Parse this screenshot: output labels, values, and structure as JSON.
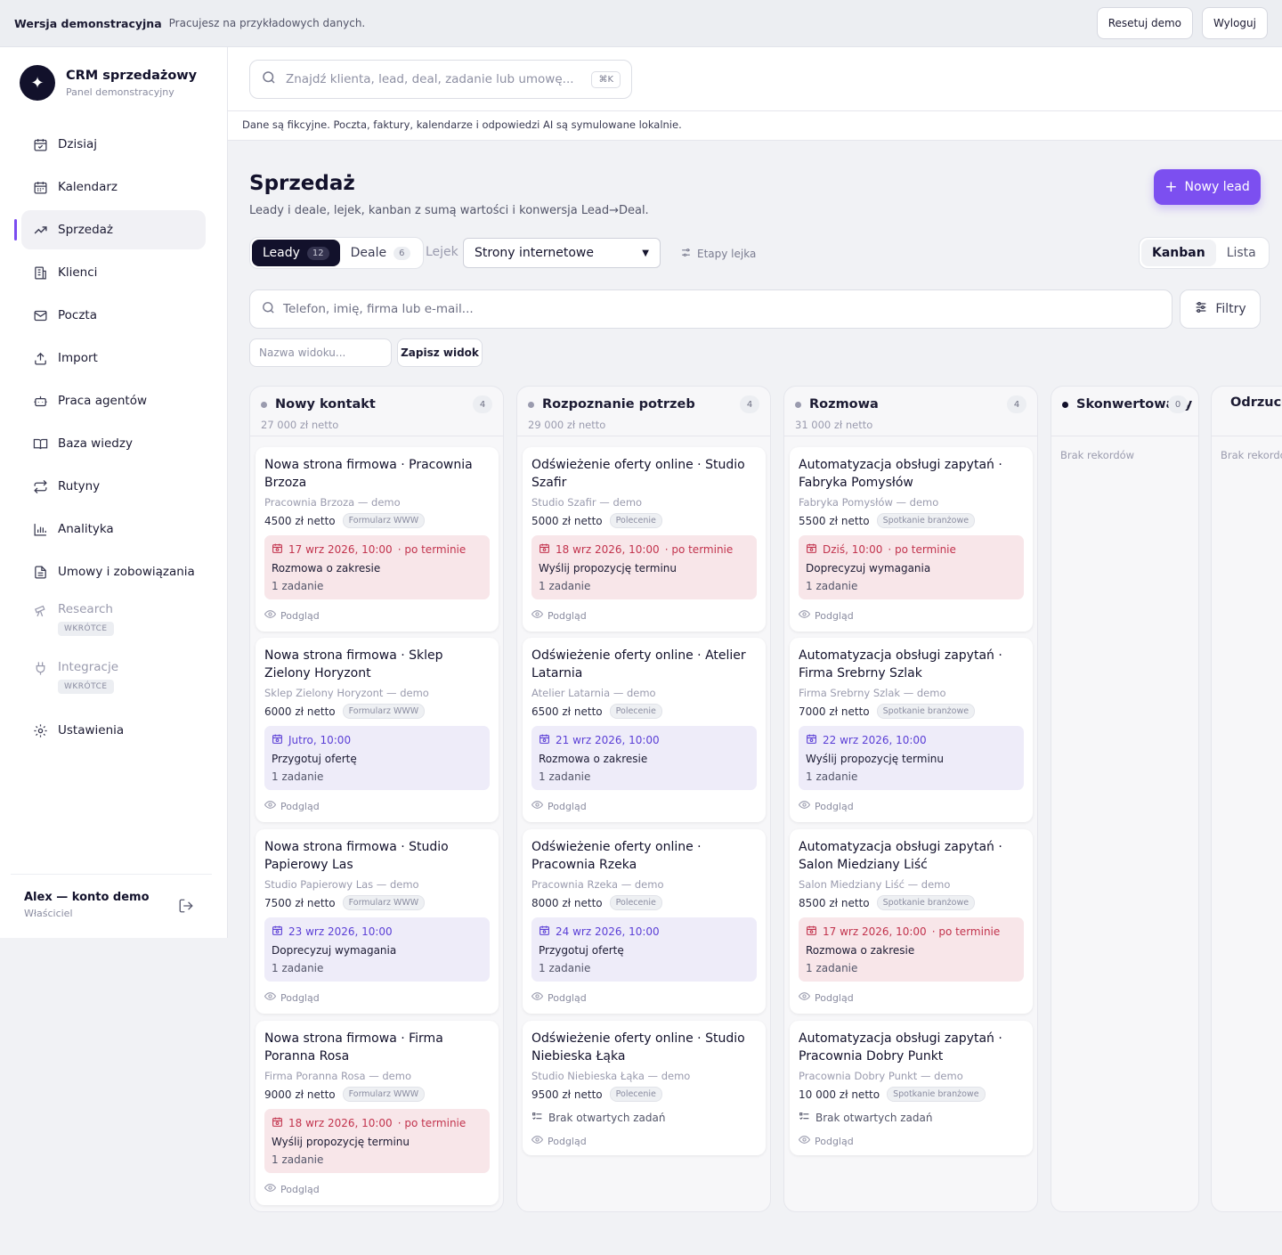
{
  "topbar": {
    "title": "Wersja demonstracyjna",
    "note": "Pracujesz na przykładowych danych.",
    "reset": "Resetuj demo",
    "logout": "Wyloguj"
  },
  "brand": {
    "name": "CRM sprzedażowy",
    "sub": "Panel demonstracyjny"
  },
  "nav": {
    "items": [
      {
        "label": "Dzisiaj",
        "icon": "calendar-check-icon"
      },
      {
        "label": "Kalendarz",
        "icon": "calendar-icon"
      },
      {
        "label": "Sprzedaż",
        "icon": "trending-up-icon",
        "active": true
      },
      {
        "label": "Klienci",
        "icon": "building-icon"
      },
      {
        "label": "Poczta",
        "icon": "mail-icon"
      },
      {
        "label": "Import",
        "icon": "upload-icon"
      },
      {
        "label": "Praca agentów",
        "icon": "bot-icon"
      },
      {
        "label": "Baza wiedzy",
        "icon": "book-icon"
      },
      {
        "label": "Rutyny",
        "icon": "repeat-icon"
      },
      {
        "label": "Analityka",
        "icon": "bar-chart-icon"
      },
      {
        "label": "Umowy i zobowiązania",
        "icon": "file-icon"
      }
    ],
    "soon": [
      {
        "label": "Research",
        "badge": "WKRÓTCE",
        "icon": "telescope-icon"
      },
      {
        "label": "Integracje",
        "badge": "WKRÓTCE",
        "icon": "plug-icon"
      }
    ],
    "settings": "Ustawienia"
  },
  "user": {
    "name": "Alex — konto demo",
    "role": "Właściciel"
  },
  "search": {
    "placeholder": "Znajdź klienta, lead, deal, zadanie lub umowę...",
    "shortcut": "⌘K"
  },
  "notice": "Dane są fikcyjne. Poczta, faktury, kalendarze i odpowiedzi AI są symulowane lokalnie.",
  "page": {
    "title": "Sprzedaż",
    "subtitle": "Leady i deale, lejek, kanban z sumą wartości i konwersja Lead→Deal.",
    "new_lead": "Nowy lead"
  },
  "tabs": {
    "leads": "Leady",
    "leads_count": "12",
    "deals": "Deale",
    "deals_count": "6"
  },
  "funnel": {
    "label": "Lejek",
    "selected": "Strony internetowe",
    "stages": "Etapy lejka"
  },
  "view": {
    "kanban": "Kanban",
    "list": "Lista"
  },
  "filter": {
    "placeholder": "Telefon, imię, firma lub e-mail...",
    "filters": "Filtry",
    "view_name": "Nazwa widoku...",
    "save": "Zapisz widok"
  },
  "columns": [
    {
      "title": "Nowy kontakt",
      "count": "4",
      "sum": "27 000 zł netto",
      "dot": "#9a9bae",
      "cards": [
        {
          "title": "Nowa strona firmowa · Pracownia Brzoza",
          "company": "Pracownia Brzoza — demo",
          "value": "4500 zł netto",
          "tag": "Formularz WWW",
          "task": {
            "date": "17 wrz 2026, 10:00",
            "overdue": "· po terminie",
            "action": "Rozmowa o zakresie",
            "count": "1 zadanie",
            "kind": "red"
          },
          "preview": "Podgląd"
        },
        {
          "title": "Nowa strona firmowa · Sklep Zielony Horyzont",
          "company": "Sklep Zielony Horyzont — demo",
          "value": "6000 zł netto",
          "tag": "Formularz WWW",
          "task": {
            "date": "Jutro, 10:00",
            "overdue": "",
            "action": "Przygotuj ofertę",
            "count": "1 zadanie",
            "kind": "purple"
          },
          "preview": "Podgląd"
        },
        {
          "title": "Nowa strona firmowa · Studio Papierowy Las",
          "company": "Studio Papierowy Las — demo",
          "value": "7500 zł netto",
          "tag": "Formularz WWW",
          "task": {
            "date": "23 wrz 2026, 10:00",
            "overdue": "",
            "action": "Doprecyzuj wymagania",
            "count": "1 zadanie",
            "kind": "purple"
          },
          "preview": "Podgląd"
        },
        {
          "title": "Nowa strona firmowa · Firma Poranna Rosa",
          "company": "Firma Poranna Rosa — demo",
          "value": "9000 zł netto",
          "tag": "Formularz WWW",
          "task": {
            "date": "18 wrz 2026, 10:00",
            "overdue": "· po terminie",
            "action": "Wyślij propozycję terminu",
            "count": "1 zadanie",
            "kind": "red"
          },
          "preview": "Podgląd"
        }
      ]
    },
    {
      "title": "Rozpoznanie potrzeb",
      "count": "4",
      "sum": "29 000 zł netto",
      "dot": "#9a9bae",
      "cards": [
        {
          "title": "Odświeżenie oferty online · Studio Szafir",
          "company": "Studio Szafir — demo",
          "value": "5000 zł netto",
          "tag": "Polecenie",
          "task": {
            "date": "18 wrz 2026, 10:00",
            "overdue": "· po terminie",
            "action": "Wyślij propozycję terminu",
            "count": "1 zadanie",
            "kind": "red"
          },
          "preview": "Podgląd"
        },
        {
          "title": "Odświeżenie oferty online · Atelier Latarnia",
          "company": "Atelier Latarnia — demo",
          "value": "6500 zł netto",
          "tag": "Polecenie",
          "task": {
            "date": "21 wrz 2026, 10:00",
            "overdue": "",
            "action": "Rozmowa o zakresie",
            "count": "1 zadanie",
            "kind": "purple"
          },
          "preview": "Podgląd"
        },
        {
          "title": "Odświeżenie oferty online · Pracownia Rzeka",
          "company": "Pracownia Rzeka — demo",
          "value": "8000 zł netto",
          "tag": "Polecenie",
          "task": {
            "date": "24 wrz 2026, 10:00",
            "overdue": "",
            "action": "Przygotuj ofertę",
            "count": "1 zadanie",
            "kind": "purple"
          },
          "preview": "Podgląd"
        },
        {
          "title": "Odświeżenie oferty online · Studio Niebieska Łąka",
          "company": "Studio Niebieska Łąka — demo",
          "value": "9500 zł netto",
          "tag": "Polecenie",
          "notask": "Brak otwartych zadań",
          "preview": "Podgląd"
        }
      ]
    },
    {
      "title": "Rozmowa",
      "count": "4",
      "sum": "31 000 zł netto",
      "dot": "#9a9bae",
      "cards": [
        {
          "title": "Automatyzacja obsługi zapytań · Fabryka Pomysłów",
          "company": "Fabryka Pomysłów — demo",
          "value": "5500 zł netto",
          "tag": "Spotkanie branżowe",
          "task": {
            "date": "Dziś, 10:00",
            "overdue": "· po terminie",
            "action": "Doprecyzuj wymagania",
            "count": "1 zadanie",
            "kind": "red"
          },
          "preview": "Podgląd"
        },
        {
          "title": "Automatyzacja obsługi zapytań · Firma Srebrny Szlak",
          "company": "Firma Srebrny Szlak — demo",
          "value": "7000 zł netto",
          "tag": "Spotkanie branżowe",
          "task": {
            "date": "22 wrz 2026, 10:00",
            "overdue": "",
            "action": "Wyślij propozycję terminu",
            "count": "1 zadanie",
            "kind": "purple"
          },
          "preview": "Podgląd"
        },
        {
          "title": "Automatyzacja obsługi zapytań · Salon Miedziany Liść",
          "company": "Salon Miedziany Liść — demo",
          "value": "8500 zł netto",
          "tag": "Spotkanie branżowe",
          "task": {
            "date": "17 wrz 2026, 10:00",
            "overdue": "· po terminie",
            "action": "Rozmowa o zakresie",
            "count": "1 zadanie",
            "kind": "red"
          },
          "preview": "Podgląd"
        },
        {
          "title": "Automatyzacja obsługi zapytań · Pracownia Dobry Punkt",
          "company": "Pracownia Dobry Punkt — demo",
          "value": "10 000 zł netto",
          "tag": "Spotkanie branżowe",
          "notask": "Brak otwartych zadań",
          "preview": "Podgląd"
        }
      ]
    },
    {
      "title": "Skonwertowany",
      "count": "0",
      "sum": "",
      "dot": "#12112b",
      "empty": "Brak rekordów",
      "cards": []
    },
    {
      "title": "Odrzucony",
      "count": "",
      "sum": "",
      "dot": "#c2334d",
      "empty": "Brak rekordów",
      "cards": []
    }
  ]
}
